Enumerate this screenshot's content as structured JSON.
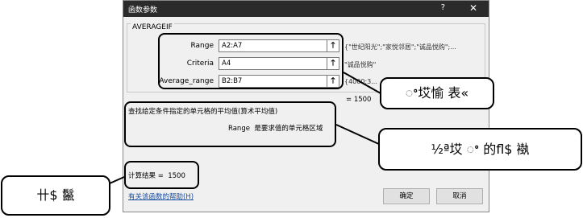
{
  "dialog": {
    "title": "函数参数",
    "help_label": "?",
    "close_label": "✕",
    "function_name": "AVERAGEIF",
    "args": [
      {
        "label": "Range",
        "value": "A2:A7",
        "result": "{\"世纪阳光\";\"家悦邻居\";\"诚品悦购\";..."
      },
      {
        "label": "Criteria",
        "value": "A4",
        "result": "\"诚品悦购\""
      },
      {
        "label": "Average_range",
        "value": "B2:B7",
        "result": "{4000;3..."
      }
    ],
    "formula_result": "1500",
    "result_prefix": "=",
    "description": "查找给定条件指定的单元格的平均值(算术平均值)",
    "param_name": "Range",
    "param_description": "是要求值的单元格区域",
    "calc_result_label": "计算结果 =",
    "calc_result_value": "1500",
    "help_link": "有关该函数的帮助(H)",
    "ok_label": "确定",
    "cancel_label": "取消"
  },
  "callouts": {
    "args": "ꢀ㘷愉 表«",
    "description": "½ª㘷 ꢀ 的ﬂ$ 褹",
    "result": "卄$ 鬣"
  }
}
